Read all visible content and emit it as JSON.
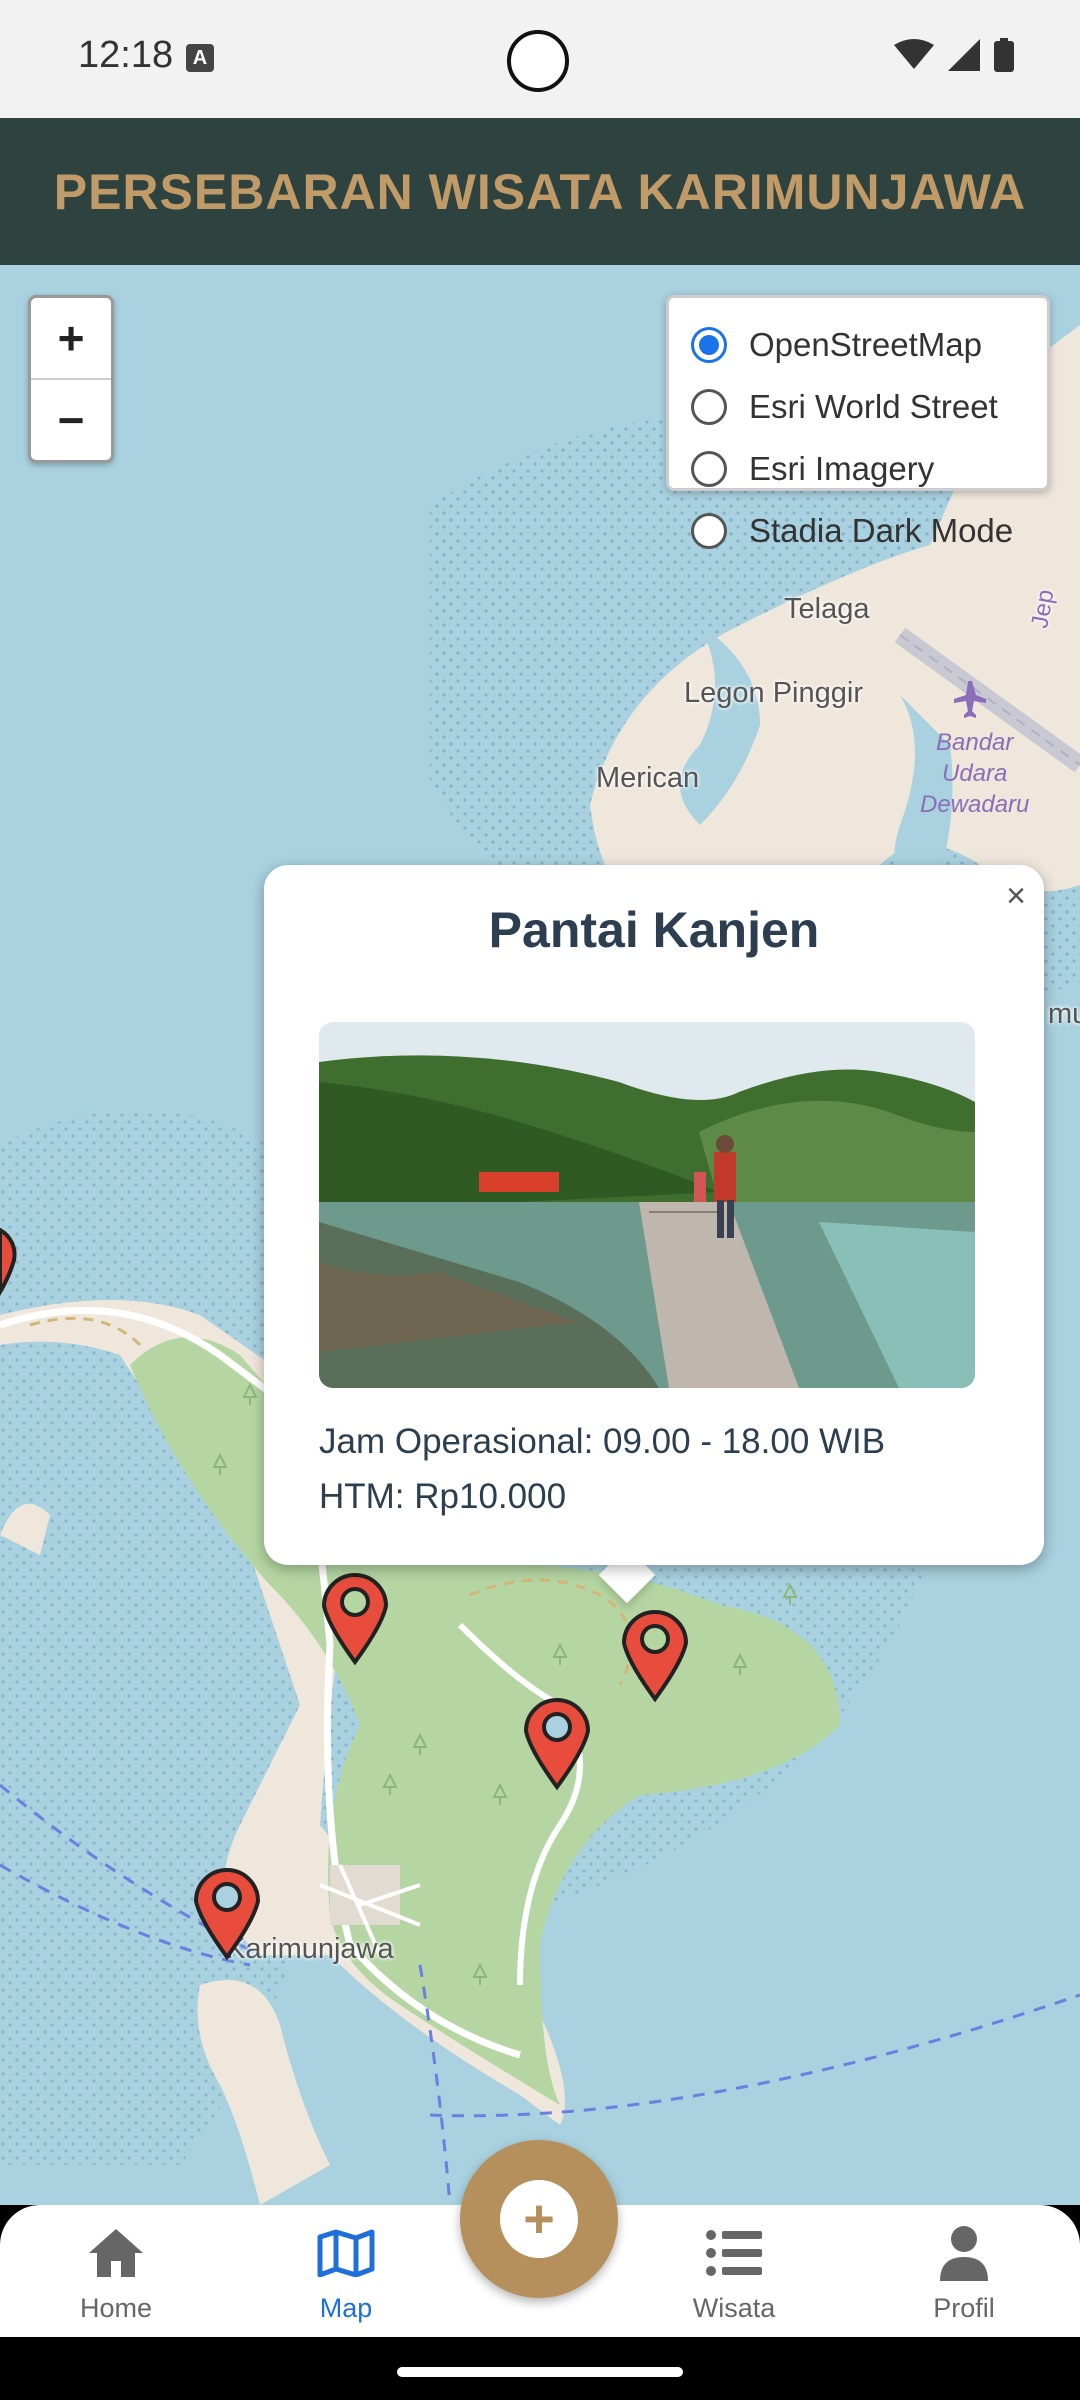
{
  "status_bar": {
    "time": "12:18",
    "notification_icon": "A"
  },
  "header": {
    "title": "PERSEBARAN WISATA KARIMUNJAWA"
  },
  "map": {
    "zoom_in": "+",
    "zoom_out": "−",
    "layers": [
      {
        "label": "OpenStreetMap",
        "checked": true
      },
      {
        "label": "Esri World Street",
        "checked": false
      },
      {
        "label": "Esri Imagery",
        "checked": false
      },
      {
        "label": "Stadia Dark Mode",
        "checked": false
      }
    ],
    "labels": {
      "telaga": "Telaga",
      "legon": "Legon Pinggir",
      "merican": "Merican",
      "karimunjawa": "Karimunjawa",
      "airport_1": "Bandar",
      "airport_2": "Udara",
      "airport_3": "Dewadaru",
      "jep": "Jep",
      "mu": "mu"
    }
  },
  "popup": {
    "close": "×",
    "title": "Pantai Kanjen",
    "hours": "Jam Operasional: 09.00 - 18.00 WIB",
    "price": "HTM: Rp10.000"
  },
  "nav": {
    "home": "Home",
    "map": "Map",
    "add": "+",
    "wisata": "Wisata",
    "profil": "Profil"
  },
  "colors": {
    "header_bg": "#2e423f",
    "title": "#c09a67",
    "accent_fab": "#b58f5c",
    "marker": "#e74c3c",
    "nav_active": "#1e6fd9"
  }
}
